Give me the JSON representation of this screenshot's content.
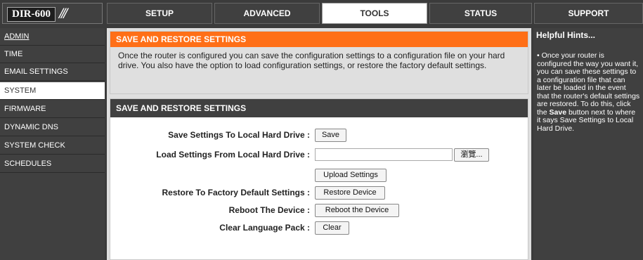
{
  "logo": {
    "text": "DIR-600",
    "slashes": "///"
  },
  "tabs": [
    {
      "label": "SETUP"
    },
    {
      "label": "ADVANCED"
    },
    {
      "label": "TOOLS"
    },
    {
      "label": "STATUS"
    },
    {
      "label": "SUPPORT"
    }
  ],
  "sidebar": {
    "items": [
      {
        "label": "ADMIN"
      },
      {
        "label": "TIME"
      },
      {
        "label": "EMAIL SETTINGS"
      },
      {
        "label": "SYSTEM"
      },
      {
        "label": "FIRMWARE"
      },
      {
        "label": "DYNAMIC DNS"
      },
      {
        "label": "SYSTEM CHECK"
      },
      {
        "label": "SCHEDULES"
      }
    ]
  },
  "intro": {
    "title": "SAVE AND RESTORE SETTINGS",
    "text": "Once the router is configured you can save the configuration settings to a configuration file on your hard drive. You also have the option to load configuration settings, or restore the factory default settings."
  },
  "form": {
    "title": "SAVE AND RESTORE SETTINGS",
    "save_label": "Save Settings To Local Hard Drive :",
    "save_button": "Save",
    "load_label": "Load Settings From Local Hard Drive :",
    "browse_button": "瀏覽...",
    "upload_button": "Upload Settings",
    "restore_label": "Restore To Factory Default Settings :",
    "restore_button": "Restore Device",
    "reboot_label": "Reboot The Device :",
    "reboot_button": "Reboot the Device",
    "clear_label": "Clear Language Pack :",
    "clear_button": "Clear"
  },
  "hints": {
    "title": "Helpful Hints...",
    "text_before": "• Once your router is configured the way you want it, you can save these settings to a configuration file that can later be loaded in the event that the router's default settings are restored. To do this, click the ",
    "text_bold": "Save",
    "text_after": " button next to where it says Save Settings to Local Hard Drive."
  }
}
